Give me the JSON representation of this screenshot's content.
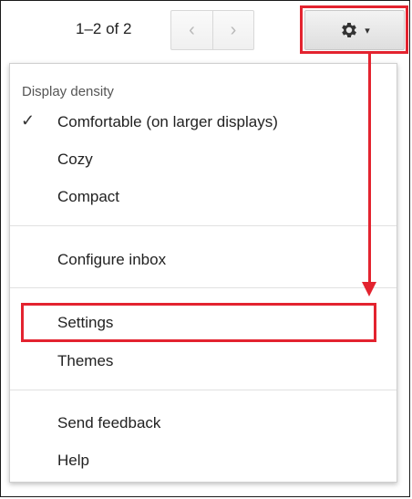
{
  "toolbar": {
    "pager_text": "1–2 of 2",
    "prev_glyph": "‹",
    "next_glyph": "›",
    "gear_icon": "gear-icon",
    "caret_glyph": "▾"
  },
  "menu": {
    "header": "Display density",
    "check_glyph": "✓",
    "density_options": [
      {
        "label": "Comfortable (on larger displays)",
        "selected": true
      },
      {
        "label": "Cozy",
        "selected": false
      },
      {
        "label": "Compact",
        "selected": false
      }
    ],
    "configure_inbox": "Configure inbox",
    "settings": "Settings",
    "themes": "Themes",
    "send_feedback": "Send feedback",
    "help": "Help"
  },
  "colors": {
    "highlight": "#e3232f",
    "menu_border": "#cfcfcf",
    "divider": "#e1e1e1"
  }
}
